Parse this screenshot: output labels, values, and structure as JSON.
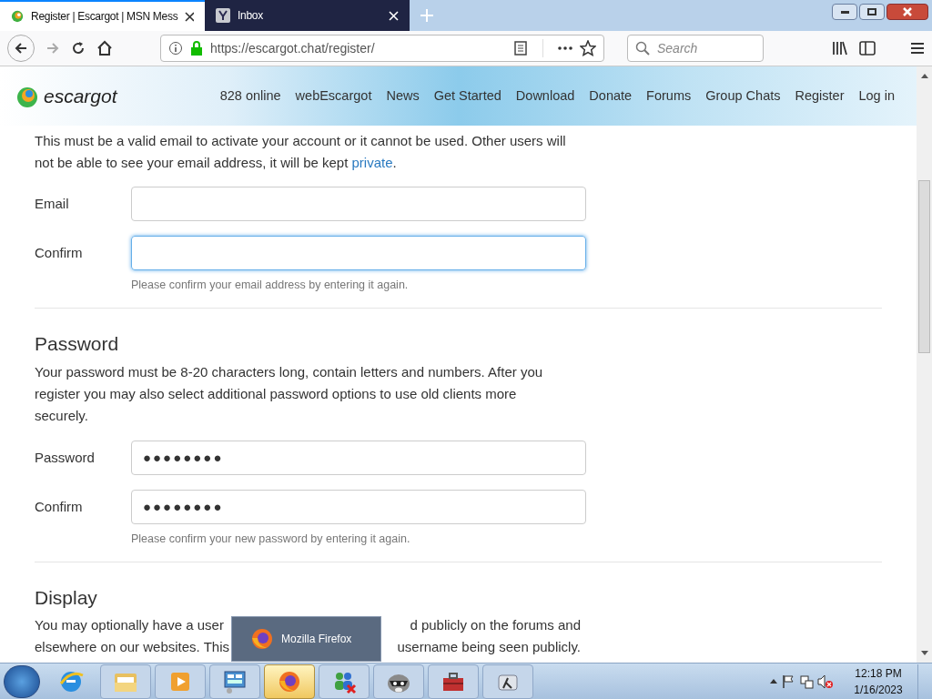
{
  "browser": {
    "tabs": [
      {
        "title": "Register | Escargot | MSN Mess",
        "selected": true,
        "kind": "escargot"
      },
      {
        "title": "Inbox",
        "selected": false,
        "kind": "mail"
      }
    ],
    "url_host": "https://escargot.chat",
    "url_path": "/register/",
    "search_placeholder": "Search"
  },
  "site": {
    "logo_text": "escargot",
    "nav": [
      "828 online",
      "webEscargot",
      "News",
      "Get Started",
      "Download",
      "Donate",
      "Forums",
      "Group Chats",
      "Register",
      "Log in"
    ]
  },
  "email_section": {
    "intro": "This must be a valid email to activate your account or it cannot be used. Other users will not be able to see your email address, it will be kept",
    "intro_link": "private",
    "intro_end": ".",
    "fields": [
      {
        "label": "Email",
        "focused": false
      },
      {
        "label": "Confirm",
        "focused": true
      }
    ],
    "hint": "Please confirm your email address by entering it again."
  },
  "password_section": {
    "heading": "Password",
    "text": "Your password must be 8-20 characters long, contain letters and numbers. After you register you may also select additional password options to use old clients more securely.",
    "fields": [
      {
        "label": "Password",
        "value": "●●●●●●●●",
        "focused": false
      },
      {
        "label": "Confirm",
        "value": "●●●●●●●●",
        "focused": false
      }
    ],
    "hint": "Please confirm your new password by entering it again."
  },
  "display_section": {
    "heading": "Display",
    "lines": [
      {
        "left": "You may optionally have a user",
        "right": "d publicly on the forums and"
      },
      {
        "left": "elsewhere on our websites. This",
        "right": "username being seen publicly."
      }
    ]
  },
  "taskbar_tooltip": "Mozilla Firefox",
  "taskbar": {
    "apps": [
      {
        "kind": "ie",
        "selected": false
      },
      {
        "kind": "folder",
        "selected": false
      },
      {
        "kind": "media",
        "selected": false
      },
      {
        "kind": "panel",
        "selected": false
      },
      {
        "kind": "firefox",
        "selected": true
      },
      {
        "kind": "people",
        "selected": false
      },
      {
        "kind": "raccoon",
        "selected": false
      },
      {
        "kind": "toolbox",
        "selected": false
      },
      {
        "kind": "lambda",
        "selected": false
      }
    ],
    "time": "12:18 PM",
    "date": "1/16/2023"
  }
}
